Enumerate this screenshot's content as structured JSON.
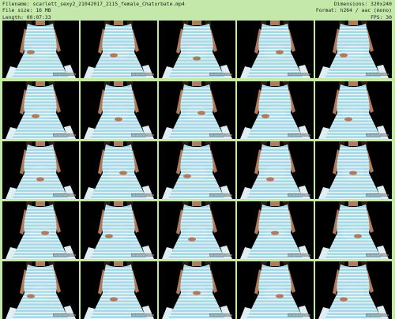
{
  "header": {
    "filename": "Filename: scarlett_sexy2_21042017_2115_female_Chaturbate.mp4",
    "filesize": "File size: 16 MB",
    "length": "Length: 00:07:33",
    "dimensions": "Dimensions: 320x240",
    "format": "Format: h264 / aac (mono)",
    "fps": "FPS: 30"
  },
  "grid": {
    "rows": 5,
    "cols": 5,
    "thumbnail_icon": "seated-woman-striped-dress-frame",
    "watermark": "stripsmart-cams"
  },
  "colors": {
    "background": "#c4e8a9",
    "dress": "#a9d9e6",
    "stripe": "#e9f6f9",
    "skin": "#b07a5c",
    "hair": "#2a1b14"
  }
}
